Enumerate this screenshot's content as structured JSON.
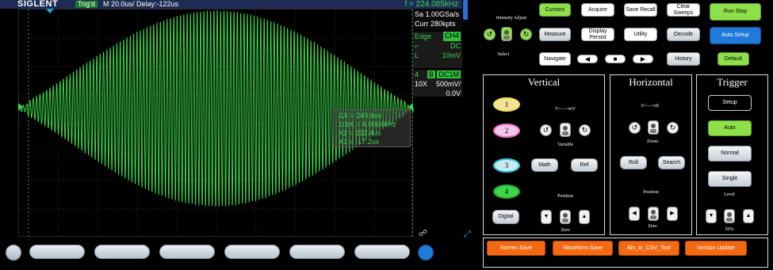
{
  "header": {
    "brand": "SIGLENT",
    "trig_status": "Trig'd",
    "timebase": "M 20.0us/  Delay:-122us",
    "frequency": "f = 224.085kHz"
  },
  "acquisition": {
    "sample_rate": "Sa 1.00GSa/s",
    "memory": "Curr 280kpts"
  },
  "trigger_info": {
    "type": "Edge",
    "source": "CH4",
    "slope_icon": "rising-edge-icon",
    "coupling": "DC",
    "level_label": "L",
    "level_value": "10mV"
  },
  "channel_info": {
    "number": "4",
    "bw_badge": "B",
    "coupling_badge": "DC1M",
    "probe": "10X",
    "scale": "500mV/",
    "offset": "0.0V"
  },
  "cursor_readout": {
    "line1": "ΔX = 249.6us",
    "line2": "1/ΔX = 4.0064kHz",
    "line3": "X2 = 232.4us",
    "line4": "X1 = -17.2us"
  },
  "waveform": {
    "color": "#3cd64a",
    "description_icon": "waveform-trace"
  },
  "softkeys": {
    "count": 6
  },
  "controls": {
    "intensity_adjust": "Intensity Adjust",
    "select": "Select",
    "cursors": "Cursors",
    "acquire": "Acquire",
    "save_recall": "Save Recall",
    "clear_sweeps": "Clear Sweeps",
    "run_stop": "Run Stop",
    "measure": "Measure",
    "display_persist": "Display Persist",
    "utility": "Utility",
    "decode": "Decode",
    "auto_setup": "Auto Setup",
    "navigate": "Navigate",
    "history": "History",
    "default": "Default"
  },
  "vertical": {
    "title": "Vertical",
    "scale_label": "V<--->mV",
    "variable": "Variable",
    "position": "Position",
    "zero": "Zero",
    "ch1": "1",
    "ch2": "2",
    "ch3": "3",
    "ch4": "4",
    "math": "Math",
    "ref": "Ref",
    "digital": "Digital"
  },
  "horizontal": {
    "title": "Horizontal",
    "scale_label": "S<--->nS",
    "zoom": "Zoom",
    "roll": "Roll",
    "search": "Search",
    "position": "Position",
    "zero": "Zero"
  },
  "trigger": {
    "title": "Trigger",
    "setup": "Setup",
    "auto": "Auto",
    "normal": "Normal",
    "single": "Single",
    "level": "Level",
    "level_pct": "50%"
  },
  "bottom_buttons": {
    "screen_save": "Screen Save",
    "waveform_save": "Waveform Save",
    "bin_to_csv": "Bin_to_CSV_Tool",
    "version_update": "Version Update"
  },
  "colors": {
    "ch1": "#f5e25a",
    "ch2": "#f070c8",
    "ch3": "#2ec6d8",
    "ch4": "#3cd64a",
    "accent_green": "#8ee04a",
    "accent_blue": "#1f7ad8",
    "accent_orange": "#f46a12"
  }
}
